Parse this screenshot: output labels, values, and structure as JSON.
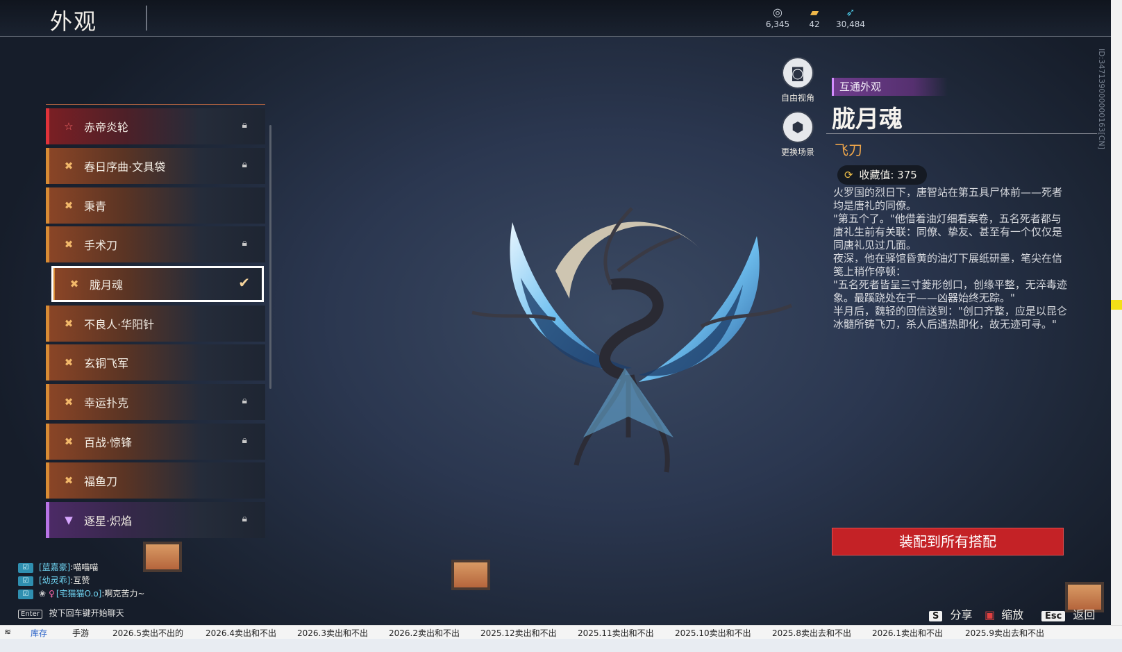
{
  "header": {
    "title": "外观",
    "resources": [
      {
        "icon": "coin-icon",
        "value": "6,345"
      },
      {
        "icon": "ticket-icon",
        "value": "42"
      },
      {
        "icon": "feather-icon",
        "value": "30,484"
      }
    ],
    "side_id": "ID:347139000000163[CN]"
  },
  "skin_list": [
    {
      "label": "赤帝炎轮",
      "rarity": "red",
      "locked": true
    },
    {
      "label": "春日序曲·文具袋",
      "rarity": "orange",
      "locked": true
    },
    {
      "label": "秉青",
      "rarity": "orange",
      "locked": false
    },
    {
      "label": "手术刀",
      "rarity": "orange",
      "locked": true
    },
    {
      "label": "胧月魂",
      "rarity": "orange",
      "locked": false,
      "selected": true
    },
    {
      "label": "不良人·华阳针",
      "rarity": "orange",
      "locked": false
    },
    {
      "label": "玄铜飞军",
      "rarity": "orange",
      "locked": false
    },
    {
      "label": "幸运扑克",
      "rarity": "orange",
      "locked": true
    },
    {
      "label": "百战·惊锋",
      "rarity": "orange",
      "locked": true
    },
    {
      "label": "福鱼刀",
      "rarity": "orange",
      "locked": false
    },
    {
      "label": "逐星·炽焰",
      "rarity": "purple",
      "locked": true
    }
  ],
  "view_buttons": {
    "free_view": "自由视角",
    "change_scene": "更换场景"
  },
  "detail": {
    "tag": "互通外观",
    "name": "胧月魂",
    "type": "飞刀",
    "collection_label": "收藏值: 375",
    "description": "火罗国的烈日下，唐智站在第五具尸体前——死者均是唐礼的同僚。\n\"第五个了。\"他借着油灯细看案卷，五名死者都与唐礼生前有关联：同僚、挚友、甚至有一个仅仅是同唐礼见过几面。\n夜深，他在驿馆昏黄的油灯下展纸研墨，笔尖在信笺上稍作停顿：\n\"五名死者皆呈三寸菱形创口，创缘平整，无淬毒迹象。最蹊跷处在于——凶器始终无踪。\"\n半月后，魏轻的回信送到：\"创口齐整，应是以昆仑冰髓所铸飞刀，杀人后遇热即化，故无迹可寻。\"",
    "equip_button": "装配到所有搭配"
  },
  "chat": [
    {
      "user": "[蓝嘉豪]",
      "msg": ":喵喵喵"
    },
    {
      "user": "[幼灵乖]",
      "msg": ":互赞"
    },
    {
      "user": "[宅猫猫O.o]",
      "msg": ":啊克苦力~"
    }
  ],
  "chat_hint": {
    "key": "Enter",
    "text": "按下回车键开始聊天"
  },
  "hints": [
    {
      "key": "S",
      "label": "分享"
    },
    {
      "key": "",
      "label": "缩放"
    },
    {
      "key": "Esc",
      "label": "返回"
    }
  ],
  "bottom_tabs": [
    "库存",
    "手游",
    "2026.5卖出不出的",
    "2026.4卖出和不出",
    "2026.3卖出和不出",
    "2026.2卖出和不出",
    "2025.12卖出和不出",
    "2025.11卖出和不出",
    "2025.10卖出和不出",
    "2025.8卖出去和不出",
    "2026.1卖出和不出",
    "2025.9卖出去和不出"
  ],
  "colors": {
    "accent_orange": "#d88b34",
    "accent_red": "#c42226",
    "accent_purple": "#b874e6"
  }
}
